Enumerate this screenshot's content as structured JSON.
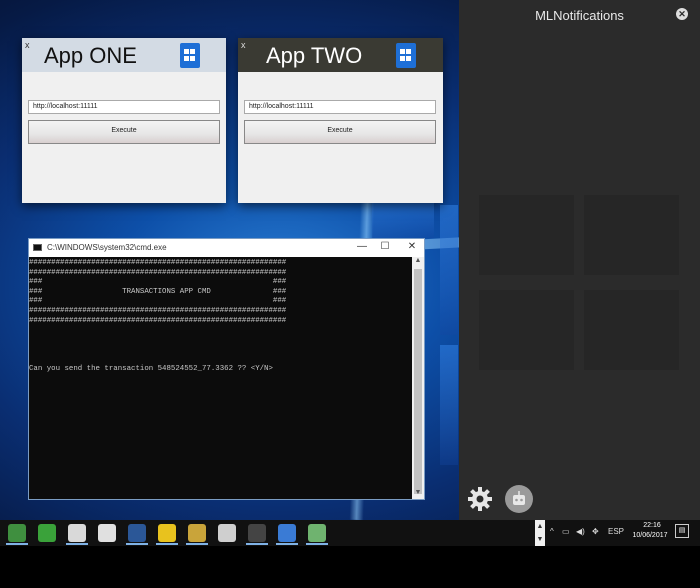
{
  "app_one": {
    "close": "x",
    "title": "App ONE",
    "url": "http://localhost:11111",
    "execute_label": "Execute"
  },
  "app_two": {
    "close": "x",
    "title": "App TWO",
    "url": "http://localhost:11111",
    "execute_label": "Execute"
  },
  "cmd": {
    "title": "C:\\WINDOWS\\system32\\cmd.exe",
    "minimize": "—",
    "maximize": "☐",
    "close": "✕",
    "lines": [
      "##########################################################",
      "##########################################################",
      "###                                                    ###",
      "###                  TRANSACTIONS APP CMD              ###",
      "###                                                    ###",
      "##########################################################",
      "##########################################################",
      "",
      "",
      "",
      "",
      "Can you send the transaction 548524552_77.3362 ?? <Y/N>"
    ]
  },
  "notifications": {
    "title": "MLNotifications",
    "close": "✕"
  },
  "taskbar": {
    "lang": "ESP",
    "time": "22:16",
    "date": "10/06/2017",
    "icons": [
      {
        "name": "terminal-app-icon",
        "color": "#3f8f3f"
      },
      {
        "name": "globe-icon",
        "color": "#3aa23a"
      },
      {
        "name": "paint-icon",
        "color": "#d9d9d9"
      },
      {
        "name": "target-icon",
        "color": "#e0e0e0"
      },
      {
        "name": "word-icon",
        "color": "#2b5797"
      },
      {
        "name": "chrome-icon",
        "color": "#e8c21e"
      },
      {
        "name": "paint-palette-icon",
        "color": "#c9a43a"
      },
      {
        "name": "settings-icon",
        "color": "#cfcfcf"
      },
      {
        "name": "cmd-icon",
        "color": "#444444"
      },
      {
        "name": "app-window-icon",
        "color": "#3a7bd5"
      },
      {
        "name": "app-pin-icon",
        "color": "#6fb36f"
      }
    ]
  },
  "colors": {
    "accent": "#1e6fd6",
    "panel": "#2b2b2b",
    "taskbar": "#111111"
  }
}
